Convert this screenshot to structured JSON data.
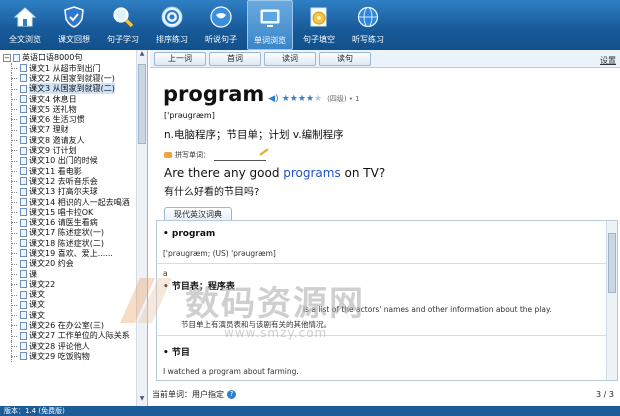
{
  "toolbar": {
    "items": [
      {
        "label": "全文浏览",
        "icon": "home-icon"
      },
      {
        "label": "课文回想",
        "icon": "shield-icon"
      },
      {
        "label": "句子学习",
        "icon": "magnifier-icon"
      },
      {
        "label": "排序练习",
        "icon": "sort-icon"
      },
      {
        "label": "听说句子",
        "icon": "speech-icon"
      },
      {
        "label": "单词浏览",
        "icon": "monitor-icon",
        "active": true
      },
      {
        "label": "句子填空",
        "icon": "cd-icon"
      },
      {
        "label": "听写练习",
        "icon": "globe-icon"
      }
    ]
  },
  "tree": {
    "root": "英语口语8000句",
    "items": [
      "课文1 从超市到出门",
      "课文2 从国家到就寝(一)",
      "课文3 从国家到就寝(二)",
      "课文4 休息日",
      "课文5 送礼物",
      "课文6 生活习惯",
      "课文7 理财",
      "课文8 邀请友人",
      "课文9 订计划",
      "课文10 出门的时候",
      "课文11 看电影",
      "课文12 去听音乐会",
      "课文13 打高尔夫球",
      "课文14 相识的人一起去喝酒",
      "课文15 唱卡拉OK",
      "课文16 请医生看病",
      "课文17 陈述症状(一)",
      "课文18 陈述症状(二)",
      "课文19 喜欢、爱上......",
      "课文20 约会",
      "课",
      "课文22",
      "课文",
      "课文",
      "课文",
      "课文26 在办公室(三)",
      "课文27 工作单位的人际关系",
      "课文28 评论他人",
      "课文29 吃饭购物"
    ],
    "selected_index": 2
  },
  "nav": {
    "buttons": [
      "上一词",
      "首词",
      "读词",
      "读句"
    ],
    "settings": "设置"
  },
  "entry": {
    "word": "program",
    "stars_on": 4,
    "stars_total": 5,
    "level": "(四级) • 1",
    "phonetic": "['prəugræm]",
    "definition": "n.电脑程序；节目单；计划 v.编制程序",
    "spell_label": "拼写单词：",
    "example_pre": "Are there any good ",
    "example_hl": "programs",
    "example_post": " on TV?",
    "example_cn": "有什么好看的节目吗?"
  },
  "dict": {
    "tab": "现代英汉词典",
    "head1": "• program",
    "phon": "['prəugræm; (US) 'prəugræm]",
    "sup": "a",
    "head2": "• 节目表；程序表",
    "line_en": "is a list of the actors' names and other information about the play.",
    "line_cn": "节目单上有演员表和与该剧有关的其他情况。",
    "head3": "• 节目",
    "line3": "I watched a program about farming."
  },
  "footer": {
    "current": "当前单词：用户指定",
    "page": "3 / 3"
  },
  "status": {
    "text": "版本：1.4    (免费版)"
  },
  "watermark": {
    "text": "数码资源网",
    "url": "www.smzy.com"
  }
}
